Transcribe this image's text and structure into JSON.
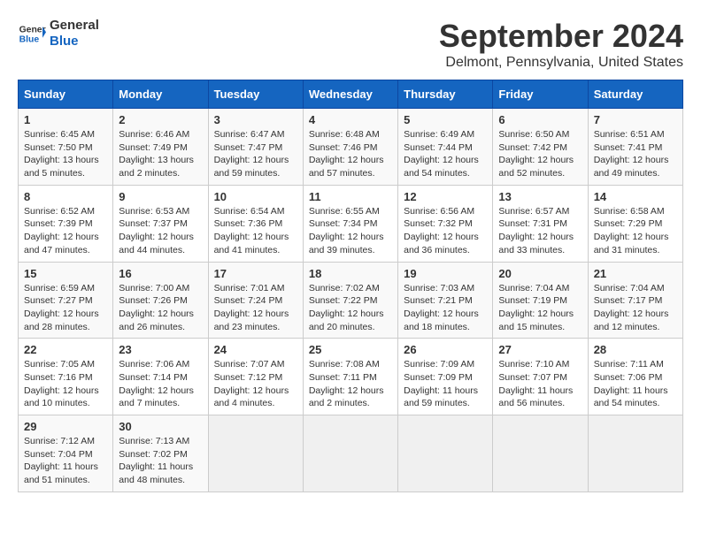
{
  "header": {
    "logo_line1": "General",
    "logo_line2": "Blue",
    "month": "September 2024",
    "location": "Delmont, Pennsylvania, United States"
  },
  "weekdays": [
    "Sunday",
    "Monday",
    "Tuesday",
    "Wednesday",
    "Thursday",
    "Friday",
    "Saturday"
  ],
  "weeks": [
    [
      {
        "day": "1",
        "info": "Sunrise: 6:45 AM\nSunset: 7:50 PM\nDaylight: 13 hours\nand 5 minutes."
      },
      {
        "day": "2",
        "info": "Sunrise: 6:46 AM\nSunset: 7:49 PM\nDaylight: 13 hours\nand 2 minutes."
      },
      {
        "day": "3",
        "info": "Sunrise: 6:47 AM\nSunset: 7:47 PM\nDaylight: 12 hours\nand 59 minutes."
      },
      {
        "day": "4",
        "info": "Sunrise: 6:48 AM\nSunset: 7:46 PM\nDaylight: 12 hours\nand 57 minutes."
      },
      {
        "day": "5",
        "info": "Sunrise: 6:49 AM\nSunset: 7:44 PM\nDaylight: 12 hours\nand 54 minutes."
      },
      {
        "day": "6",
        "info": "Sunrise: 6:50 AM\nSunset: 7:42 PM\nDaylight: 12 hours\nand 52 minutes."
      },
      {
        "day": "7",
        "info": "Sunrise: 6:51 AM\nSunset: 7:41 PM\nDaylight: 12 hours\nand 49 minutes."
      }
    ],
    [
      {
        "day": "8",
        "info": "Sunrise: 6:52 AM\nSunset: 7:39 PM\nDaylight: 12 hours\nand 47 minutes."
      },
      {
        "day": "9",
        "info": "Sunrise: 6:53 AM\nSunset: 7:37 PM\nDaylight: 12 hours\nand 44 minutes."
      },
      {
        "day": "10",
        "info": "Sunrise: 6:54 AM\nSunset: 7:36 PM\nDaylight: 12 hours\nand 41 minutes."
      },
      {
        "day": "11",
        "info": "Sunrise: 6:55 AM\nSunset: 7:34 PM\nDaylight: 12 hours\nand 39 minutes."
      },
      {
        "day": "12",
        "info": "Sunrise: 6:56 AM\nSunset: 7:32 PM\nDaylight: 12 hours\nand 36 minutes."
      },
      {
        "day": "13",
        "info": "Sunrise: 6:57 AM\nSunset: 7:31 PM\nDaylight: 12 hours\nand 33 minutes."
      },
      {
        "day": "14",
        "info": "Sunrise: 6:58 AM\nSunset: 7:29 PM\nDaylight: 12 hours\nand 31 minutes."
      }
    ],
    [
      {
        "day": "15",
        "info": "Sunrise: 6:59 AM\nSunset: 7:27 PM\nDaylight: 12 hours\nand 28 minutes."
      },
      {
        "day": "16",
        "info": "Sunrise: 7:00 AM\nSunset: 7:26 PM\nDaylight: 12 hours\nand 26 minutes."
      },
      {
        "day": "17",
        "info": "Sunrise: 7:01 AM\nSunset: 7:24 PM\nDaylight: 12 hours\nand 23 minutes."
      },
      {
        "day": "18",
        "info": "Sunrise: 7:02 AM\nSunset: 7:22 PM\nDaylight: 12 hours\nand 20 minutes."
      },
      {
        "day": "19",
        "info": "Sunrise: 7:03 AM\nSunset: 7:21 PM\nDaylight: 12 hours\nand 18 minutes."
      },
      {
        "day": "20",
        "info": "Sunrise: 7:04 AM\nSunset: 7:19 PM\nDaylight: 12 hours\nand 15 minutes."
      },
      {
        "day": "21",
        "info": "Sunrise: 7:04 AM\nSunset: 7:17 PM\nDaylight: 12 hours\nand 12 minutes."
      }
    ],
    [
      {
        "day": "22",
        "info": "Sunrise: 7:05 AM\nSunset: 7:16 PM\nDaylight: 12 hours\nand 10 minutes."
      },
      {
        "day": "23",
        "info": "Sunrise: 7:06 AM\nSunset: 7:14 PM\nDaylight: 12 hours\nand 7 minutes."
      },
      {
        "day": "24",
        "info": "Sunrise: 7:07 AM\nSunset: 7:12 PM\nDaylight: 12 hours\nand 4 minutes."
      },
      {
        "day": "25",
        "info": "Sunrise: 7:08 AM\nSunset: 7:11 PM\nDaylight: 12 hours\nand 2 minutes."
      },
      {
        "day": "26",
        "info": "Sunrise: 7:09 AM\nSunset: 7:09 PM\nDaylight: 11 hours\nand 59 minutes."
      },
      {
        "day": "27",
        "info": "Sunrise: 7:10 AM\nSunset: 7:07 PM\nDaylight: 11 hours\nand 56 minutes."
      },
      {
        "day": "28",
        "info": "Sunrise: 7:11 AM\nSunset: 7:06 PM\nDaylight: 11 hours\nand 54 minutes."
      }
    ],
    [
      {
        "day": "29",
        "info": "Sunrise: 7:12 AM\nSunset: 7:04 PM\nDaylight: 11 hours\nand 51 minutes."
      },
      {
        "day": "30",
        "info": "Sunrise: 7:13 AM\nSunset: 7:02 PM\nDaylight: 11 hours\nand 48 minutes."
      },
      {
        "day": "",
        "info": ""
      },
      {
        "day": "",
        "info": ""
      },
      {
        "day": "",
        "info": ""
      },
      {
        "day": "",
        "info": ""
      },
      {
        "day": "",
        "info": ""
      }
    ]
  ]
}
